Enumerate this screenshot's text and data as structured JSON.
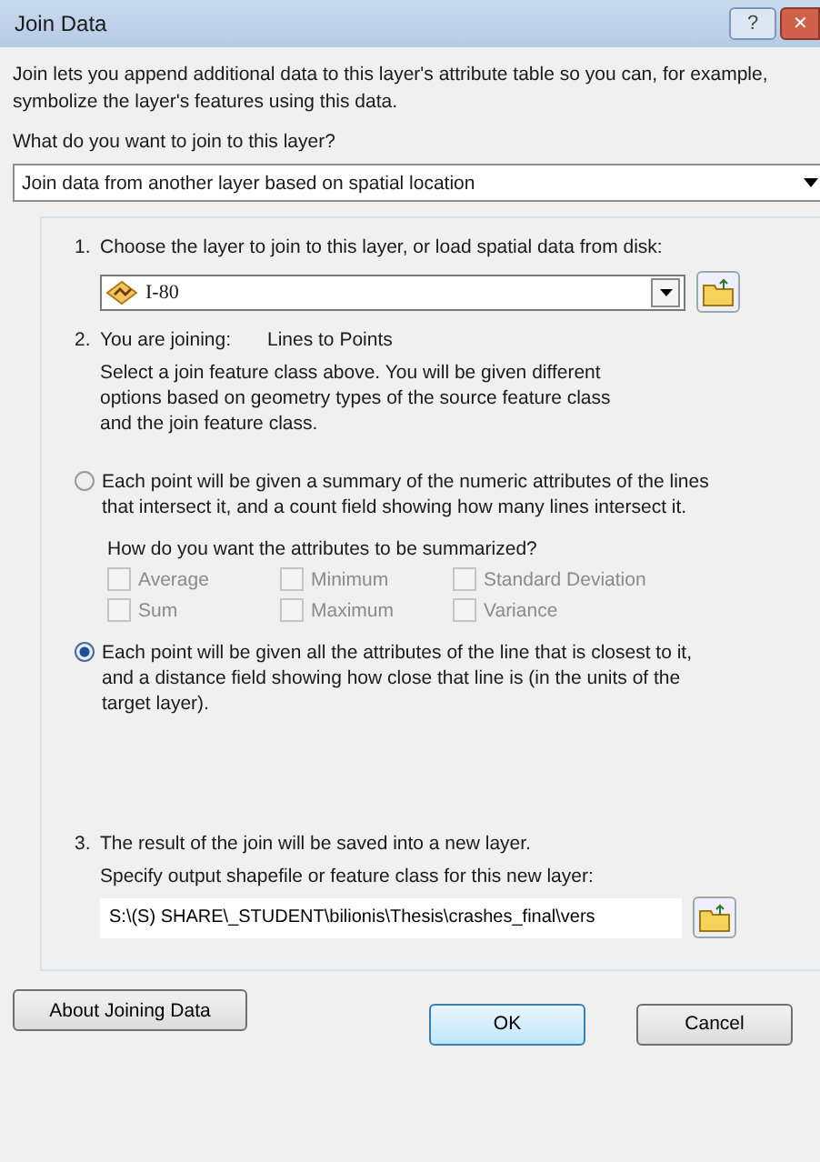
{
  "window": {
    "title": "Join Data",
    "help": "?",
    "close": "✕"
  },
  "intro": "Join lets you append additional data to this layer's attribute table so you can, for example, symbolize the layer's features using this data.",
  "join_question": "What do you want to join to this layer?",
  "join_type": {
    "value": "Join data from another layer based on spatial location"
  },
  "step1": {
    "number": "1.",
    "label": "Choose the layer to join to this layer, or load spatial data from disk:",
    "layer": {
      "value": "I-80"
    }
  },
  "step2": {
    "number": "2.",
    "label": "You are joining:",
    "value": "Lines to Points",
    "help": "Select a join feature class above.  You will be given different options based on geometry types of the source feature class and the join feature class.",
    "options": [
      {
        "label": "Each point will be given a summary of the numeric attributes of the lines that intersect it, and a count field showing how many lines intersect it.",
        "selected": false
      },
      {
        "label": "Each point will be given all the attributes of the line that is closest to it, and a distance field showing how close that line is (in the units of the target layer).",
        "selected": true
      }
    ],
    "summary_question": "How do you want the attributes to be summarized?",
    "summaries": [
      {
        "label": "Average",
        "checked": false,
        "disabled": true
      },
      {
        "label": "Minimum",
        "checked": false,
        "disabled": true
      },
      {
        "label": "Standard Deviation",
        "checked": false,
        "disabled": true
      },
      {
        "label": "Sum",
        "checked": false,
        "disabled": true
      },
      {
        "label": "Maximum",
        "checked": false,
        "disabled": true
      },
      {
        "label": "Variance",
        "checked": false,
        "disabled": true
      }
    ]
  },
  "step3": {
    "number": "3.",
    "label": "The result of the join will be saved into a new layer.",
    "sublabel": "Specify output shapefile or feature class for this new layer:",
    "output": {
      "value": "S:\\(S) SHARE\\_STUDENT\\bilionis\\Thesis\\crashes_final\\vers"
    }
  },
  "buttons": [
    {
      "label": "About Joining Data",
      "kind": "help"
    },
    {
      "label": "OK",
      "kind": "default"
    },
    {
      "label": "Cancel",
      "kind": "plain"
    }
  ]
}
